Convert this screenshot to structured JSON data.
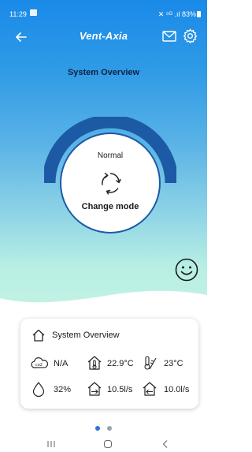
{
  "status_bar": {
    "time": "11:29",
    "right_text": "✕ ⁵ᴳ .ıl 83%"
  },
  "header": {
    "brand": "Vent-Axia",
    "back_icon": "arrow-left-icon",
    "mail_icon": "mail-icon",
    "settings_icon": "gear-icon"
  },
  "main": {
    "title": "System Overview",
    "mode_status": "Normal",
    "change_mode_label": "Change mode",
    "mode_icon": "refresh-cycle-icon",
    "status_face_icon": "smiley-face-icon"
  },
  "overview_card": {
    "title": "System Overview",
    "title_icon": "house-outline-icon",
    "co2": {
      "icon": "co2-cloud-icon",
      "value": "N/A"
    },
    "indoor_temp": {
      "icon": "house-thermometer-icon",
      "value": "22.9°C"
    },
    "outdoor_temp": {
      "icon": "thermometer-outdoor-icon",
      "value": "23°C"
    },
    "humidity": {
      "icon": "water-drop-icon",
      "value": "32%"
    },
    "extract_flow": {
      "icon": "house-arrow-out-icon",
      "value": "10.5l/s"
    },
    "supply_flow": {
      "icon": "house-arrow-in-icon",
      "value": "10.0l/s"
    }
  },
  "pager": {
    "pages": 2,
    "active": 1
  },
  "colors": {
    "gradient_top": "#1a8ae8",
    "gradient_bottom": "#c4f3e4",
    "gauge_arc": "#1c5aa6",
    "title_text": "#0f2340",
    "accent_dot": "#2a78d6"
  }
}
